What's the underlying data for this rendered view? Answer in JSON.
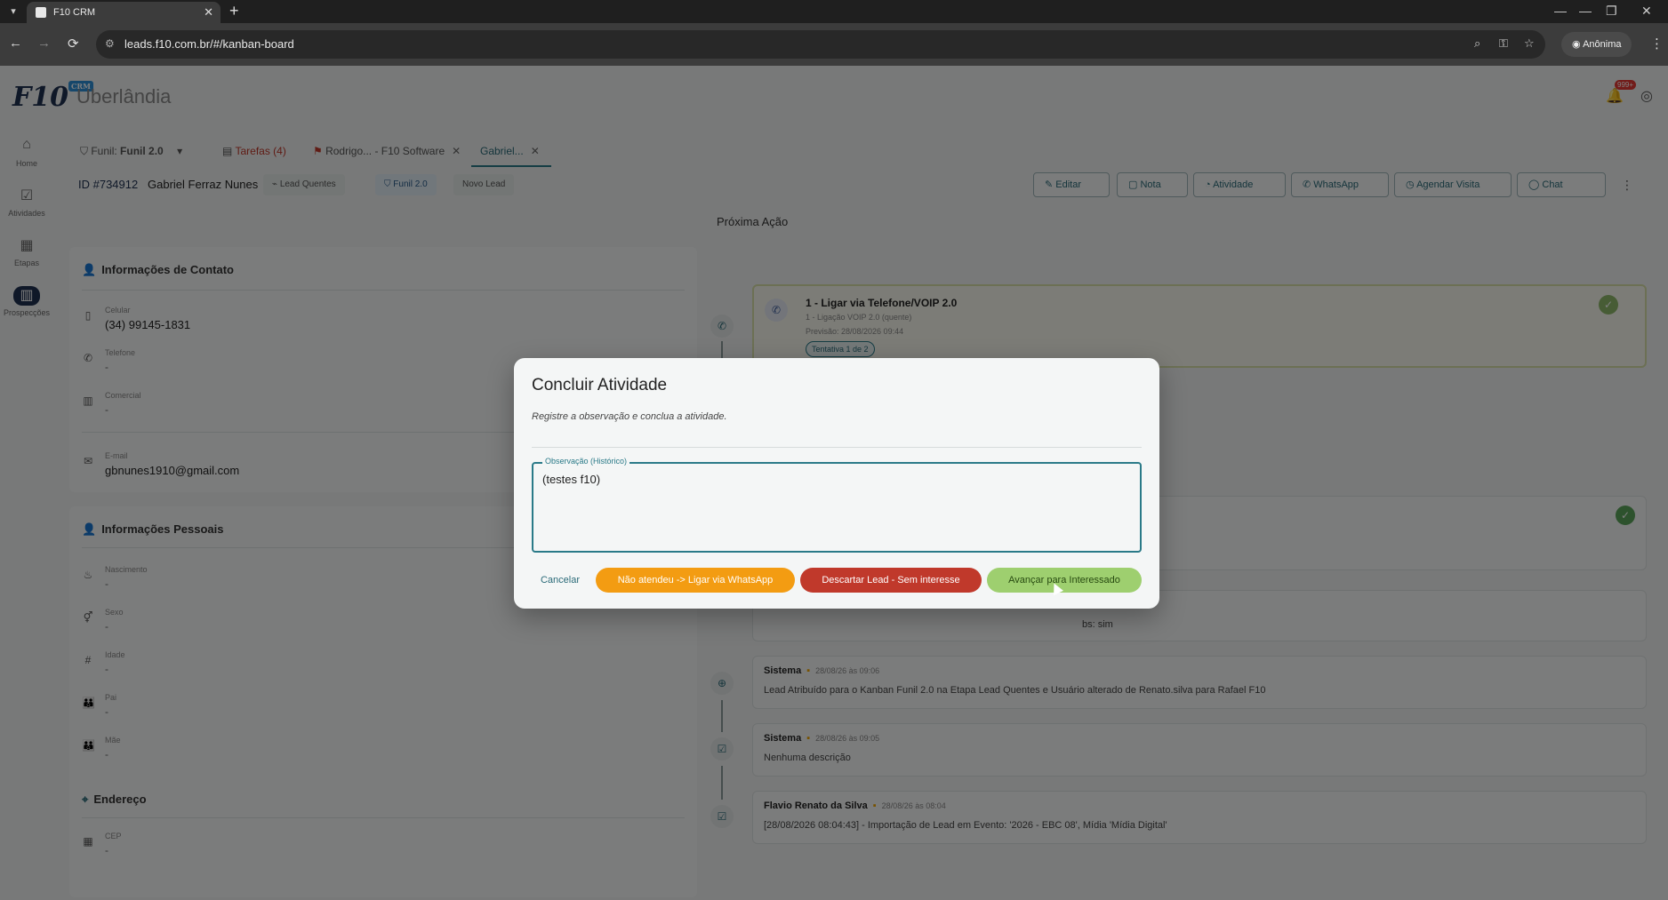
{
  "browser": {
    "tab_title": "F10 CRM",
    "url": "leads.f10.com.br/#/kanban-board",
    "profile": "Anônima"
  },
  "app": {
    "logo": "F10",
    "logo_badge": "CRM",
    "city": "Uberlândia",
    "notifications": "999+"
  },
  "sidebar": {
    "items": [
      {
        "label": "Home",
        "icon": "home-icon"
      },
      {
        "label": "Atividades",
        "icon": "checklist-icon"
      },
      {
        "label": "Etapas",
        "icon": "calendar-icon"
      },
      {
        "label": "Prospecções",
        "icon": "kanban-icon"
      }
    ]
  },
  "tabs": {
    "funnel_label": "Funil:",
    "funnel_value": "Funil 2.0",
    "tasks": "Tarefas (4)",
    "tab_rodrigo": "Rodrigo... - F10 Software",
    "tab_gabriel": "Gabriel..."
  },
  "lead": {
    "id": "ID #734912",
    "name": "Gabriel Ferraz Nunes",
    "chip_stage": "Lead Quentes",
    "chip_funnel": "Funil 2.0",
    "chip_new": "Novo Lead",
    "actions": [
      "Editar",
      "Nota",
      "Atividade",
      "WhatsApp",
      "Agendar Visita",
      "Chat"
    ]
  },
  "contact": {
    "title": "Informações de Contato",
    "fields": [
      {
        "label": "Celular",
        "value": "(34) 99145-1831"
      },
      {
        "label": "Telefone",
        "value": "-"
      },
      {
        "label": "Comercial",
        "value": "-"
      },
      {
        "label": "E-mail",
        "value": "gbnunes1910@gmail.com"
      }
    ]
  },
  "personal": {
    "title": "Informações Pessoais",
    "fields": [
      {
        "label": "Nascimento",
        "value": "-"
      },
      {
        "label": "Sexo",
        "value": "-"
      },
      {
        "label": "Idade",
        "value": "-"
      },
      {
        "label": "Pai",
        "value": "-"
      },
      {
        "label": "Mãe",
        "value": "-"
      }
    ]
  },
  "address": {
    "title": "Endereço",
    "fields": [
      {
        "label": "CEP",
        "value": "-"
      }
    ]
  },
  "timeline": {
    "next_title": "Próxima Ação",
    "next_card": {
      "title": "1 - Ligar via Telefone/VOIP 2.0",
      "subtitle": "1 - Ligação VOIP 2.0 (quente)",
      "forecast": "Previsão: 28/08/2026 09:44",
      "attempt": "Tentativa 1 de 2"
    },
    "partial_text": "bs: sim",
    "entries": [
      {
        "author": "Sistema",
        "date": "28/08/26 às 09:06",
        "text": "Lead Atribuído para o Kanban Funil 2.0 na Etapa Lead Quentes e Usuário alterado de Renato.silva para Rafael F10"
      },
      {
        "author": "Sistema",
        "date": "28/08/26 às 09:05",
        "text": "Nenhuma descrição"
      },
      {
        "author": "Flavio Renato da Silva",
        "date": "28/08/26 às 08:04",
        "text": "[28/08/2026 08:04:43] - Importação de Lead em Evento: '2026 - EBC 08', Mídia 'Mídia Digital'"
      }
    ]
  },
  "dialog": {
    "title": "Concluir Atividade",
    "subtitle": "Registre a observação e conclua a atividade.",
    "field_label": "Observação (Histórico)",
    "field_value": "(testes f10)",
    "cancel": "Cancelar",
    "btn_whatsapp": "Não atendeu -> Ligar via WhatsApp",
    "btn_discard": "Descartar Lead - Sem interesse",
    "btn_advance": "Avançar para Interessado"
  }
}
